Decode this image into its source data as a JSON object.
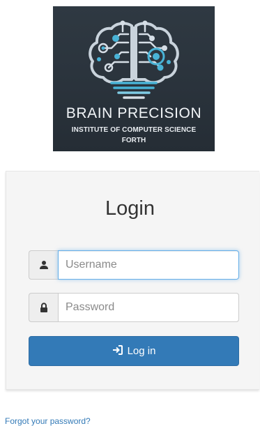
{
  "logo": {
    "title": "BRAIN PRECISION",
    "subtitle_line1": "INSTITUTE OF COMPUTER SCIENCE",
    "subtitle_line2": "FORTH"
  },
  "login": {
    "heading": "Login",
    "username": {
      "placeholder": "Username",
      "value": "",
      "icon": "user-icon"
    },
    "password": {
      "placeholder": "Password",
      "value": "",
      "icon": "lock-icon"
    },
    "submit_label": "Log in",
    "submit_icon": "sign-in-icon"
  },
  "footer": {
    "forgot_label": "Forgot your password?"
  },
  "colors": {
    "primary": "#337ab7",
    "link": "#337ab7",
    "logo_bg": "#2a333c",
    "logo_accent": "#49b3d6"
  }
}
